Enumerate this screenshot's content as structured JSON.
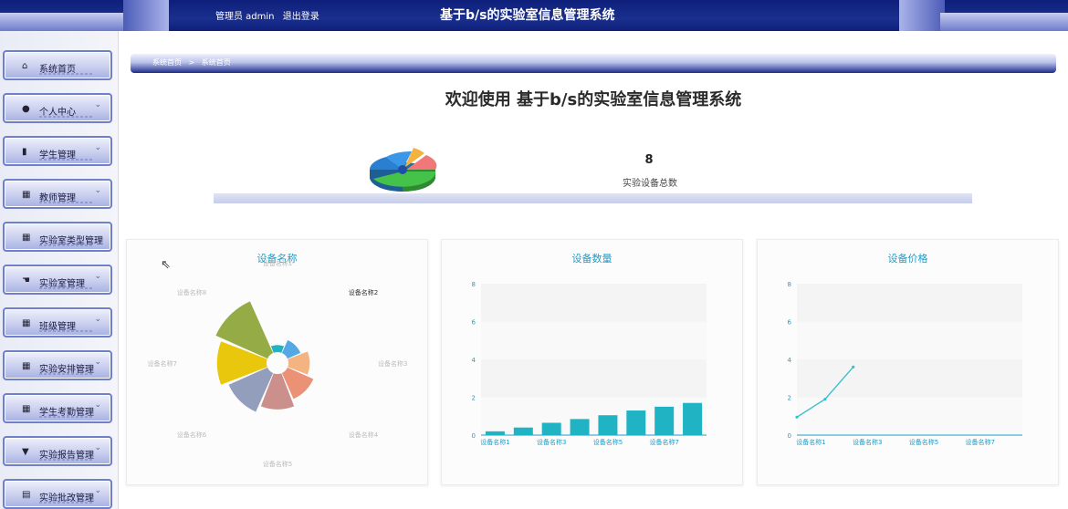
{
  "header": {
    "admin_label": "管理员 admin",
    "logout_label": "退出登录",
    "title": "基于b/s的实验室信息管理系统"
  },
  "sidebar": {
    "items": [
      {
        "label": "系统首页",
        "icon": "home-icon",
        "glyph": "⌂",
        "chevron": false
      },
      {
        "label": "个人中心",
        "icon": "user-icon",
        "glyph": "●",
        "chevron": true
      },
      {
        "label": "学生管理",
        "icon": "bar-chart-icon",
        "glyph": "▮",
        "chevron": true
      },
      {
        "label": "教师管理",
        "icon": "grid-icon",
        "glyph": "▦",
        "chevron": true
      },
      {
        "label": "实验室类型管理",
        "icon": "grid-icon",
        "glyph": "▦",
        "chevron": false
      },
      {
        "label": "实验室管理",
        "icon": "hand-icon",
        "glyph": "☚",
        "chevron": true
      },
      {
        "label": "班级管理",
        "icon": "grid-icon",
        "glyph": "▦",
        "chevron": true
      },
      {
        "label": "实验安排管理",
        "icon": "grid-icon",
        "glyph": "▦",
        "chevron": true
      },
      {
        "label": "学生考勤管理",
        "icon": "grid-icon",
        "glyph": "▦",
        "chevron": true
      },
      {
        "label": "实验报告管理",
        "icon": "trophy-icon",
        "glyph": "▼",
        "chevron": true
      },
      {
        "label": "实验批改管理",
        "icon": "calendar-icon",
        "glyph": "▤",
        "chevron": true
      }
    ]
  },
  "breadcrumb": {
    "home": "系统首页",
    "separator": ">",
    "current": "系统首页"
  },
  "welcome": "欢迎使用 基于b/s的实验室信息管理系统",
  "stat": {
    "value": "8",
    "label": "实验设备总数"
  },
  "colors": {
    "accent": "#1e9dc7",
    "bar": "#1fb3c4",
    "header": "#0d1f7a"
  },
  "chart_data": [
    {
      "type": "pie",
      "title": "设备名称",
      "rose": true,
      "categories": [
        "设备名称1",
        "设备名称2",
        "设备名称3",
        "设备名称4",
        "设备名称5",
        "设备名称6",
        "设备名称7",
        "设备名称8"
      ],
      "values": [
        1,
        2,
        3,
        4,
        5,
        6,
        7,
        8
      ],
      "highlighted": "设备名称2",
      "colors": [
        "#1fb3c4",
        "#4ba3e3",
        "#f2b07a",
        "#e98b6f",
        "#c98a86",
        "#8d99b8",
        "#e8c400",
        "#8fa83c"
      ]
    },
    {
      "type": "bar",
      "title": "设备数量",
      "categories": [
        "设备名称1",
        "设备名称2",
        "设备名称3",
        "设备名称4",
        "设备名称5",
        "设备名称6",
        "设备名称7",
        "设备名称8"
      ],
      "tick_labels": [
        "设备名称1",
        "设备名称3",
        "设备名称5",
        "设备名称7"
      ],
      "values": [
        0.2,
        0.4,
        0.65,
        0.85,
        1.05,
        1.3,
        1.5,
        1.7
      ],
      "yticks": [
        0,
        2,
        4,
        6,
        8
      ],
      "ylim": [
        0,
        8
      ]
    },
    {
      "type": "line",
      "title": "设备价格",
      "categories": [
        "设备名称1",
        "设备名称2",
        "设备名称3",
        "设备名称4",
        "设备名称5",
        "设备名称6",
        "设备名称7",
        "设备名称8"
      ],
      "tick_labels": [
        "设备名称1",
        "设备名称3",
        "设备名称5",
        "设备名称7"
      ],
      "values": [
        0.95,
        1.9,
        3.6
      ],
      "yticks": [
        0,
        2,
        4,
        6,
        8
      ],
      "ylim": [
        0,
        8
      ]
    }
  ]
}
